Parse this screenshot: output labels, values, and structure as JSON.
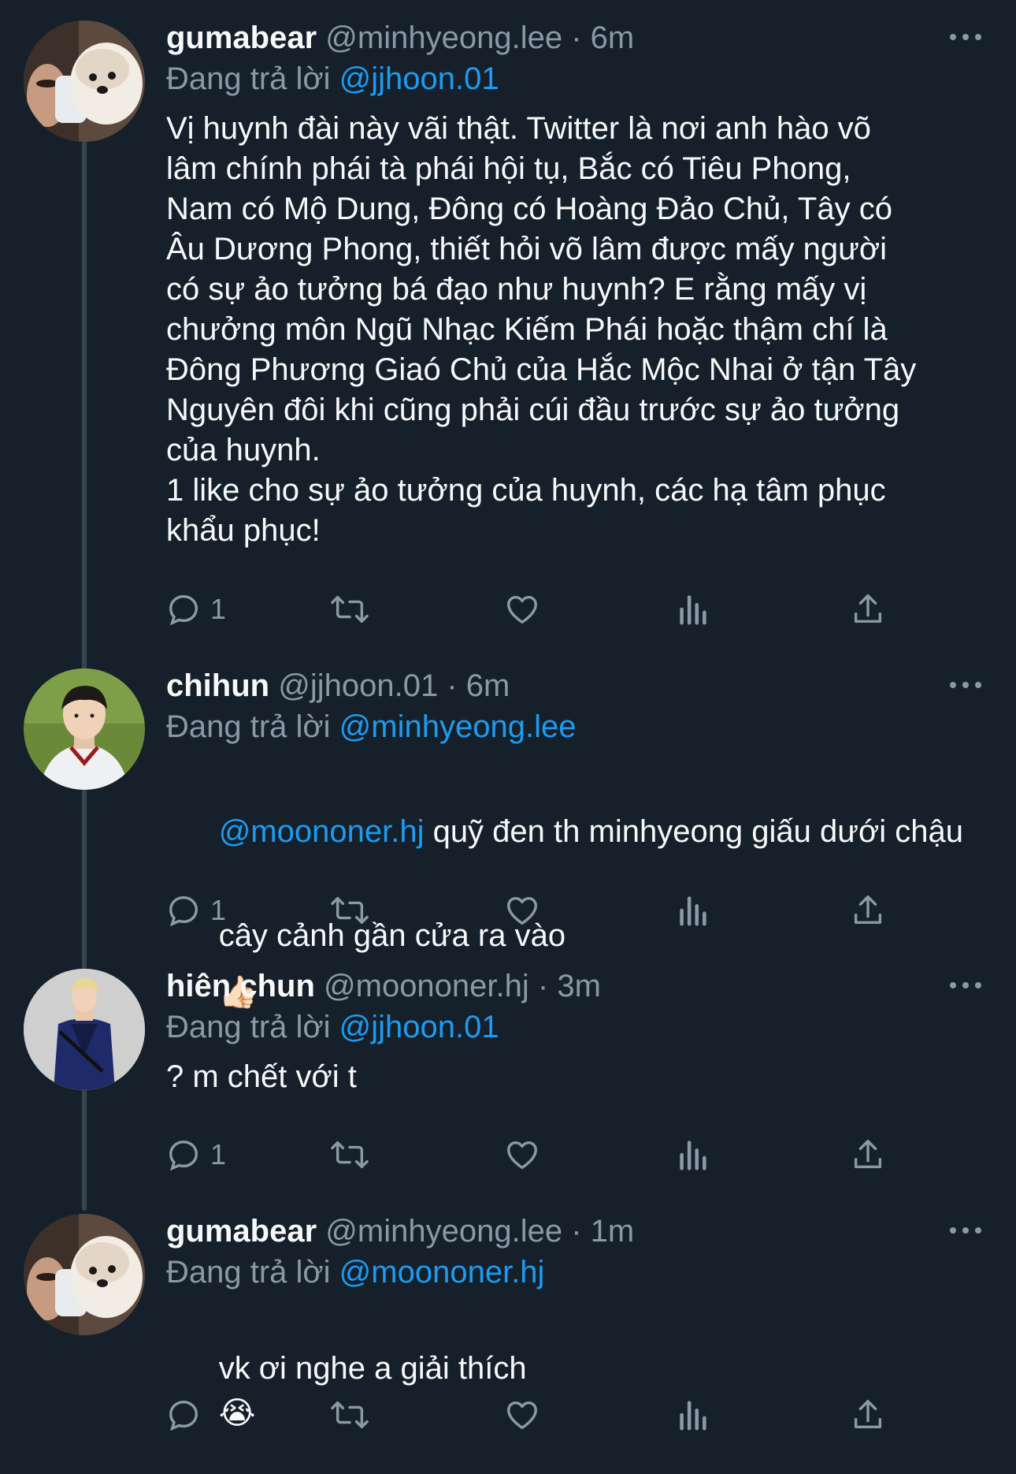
{
  "tweets": [
    {
      "display_name": "gumabear",
      "handle": "@minhyeong.lee",
      "separator": "·",
      "time": "6m",
      "reply_prefix": "Đang trả lời",
      "reply_to": "@jjhoon.01",
      "body": "Vị huynh đài này vãi thật. Twitter là nơi anh hào võ\nlâm chính phái tà phái hội tụ, Bắc có Tiêu Phong,\nNam có Mộ Dung, Đông có Hoàng Đảo Chủ, Tây có\nÂu Dương Phong, thiết hỏi võ lâm được mấy người\ncó sự ảo tưởng bá đạo như huynh? E rằng mấy vị\nchưởng môn Ngũ Nhạc Kiếm Phái hoặc thậm chí là\nĐông Phương Giaó Chủ của Hắc Mộc Nhai ở tận Tây\nNguyên đôi khi cũng phải cúi đầu trước sự ảo tưởng\ncủa huynh.\n1 like cho sự ảo tưởng của huynh, các hạ tâm phục\nkhẩu phục!",
      "reply_count": "1",
      "avatar_icon": "pomeranian-dog-avatar"
    },
    {
      "display_name": "chihun",
      "handle": "@jjhoon.01",
      "separator": "·",
      "time": "6m",
      "reply_prefix": "Đang trả lời",
      "reply_to": "@minhyeong.lee",
      "body_mention": "@moononer.hj",
      "body_line1": " quỹ đen th minhyeong giấu dưới chậu",
      "body_line2": "cây cảnh gần cửa ra vào",
      "emoji": "👍🏻",
      "reply_count": "1",
      "avatar_icon": "person-baseball-jersey-avatar"
    },
    {
      "display_name": "hiên chun",
      "handle": "@moononer.hj",
      "separator": "·",
      "time": "3m",
      "reply_prefix": "Đang trả lời",
      "reply_to": "@jjhoon.01",
      "body": "? m chết với t",
      "reply_count": "1",
      "avatar_icon": "person-blue-jacket-avatar"
    },
    {
      "display_name": "gumabear",
      "handle": "@minhyeong.lee",
      "separator": "·",
      "time": "1m",
      "reply_prefix": "Đang trả lời",
      "reply_to": "@moononer.hj",
      "body": "vk ơi nghe a giải thích",
      "emoji": "😭",
      "reply_count": "",
      "avatar_icon": "pomeranian-dog-avatar"
    }
  ],
  "colors": {
    "background": "#15202b",
    "text": "#f7f9f9",
    "secondary": "#8b98a5",
    "link": "#1d9bf0",
    "thread_line": "#38444d"
  }
}
